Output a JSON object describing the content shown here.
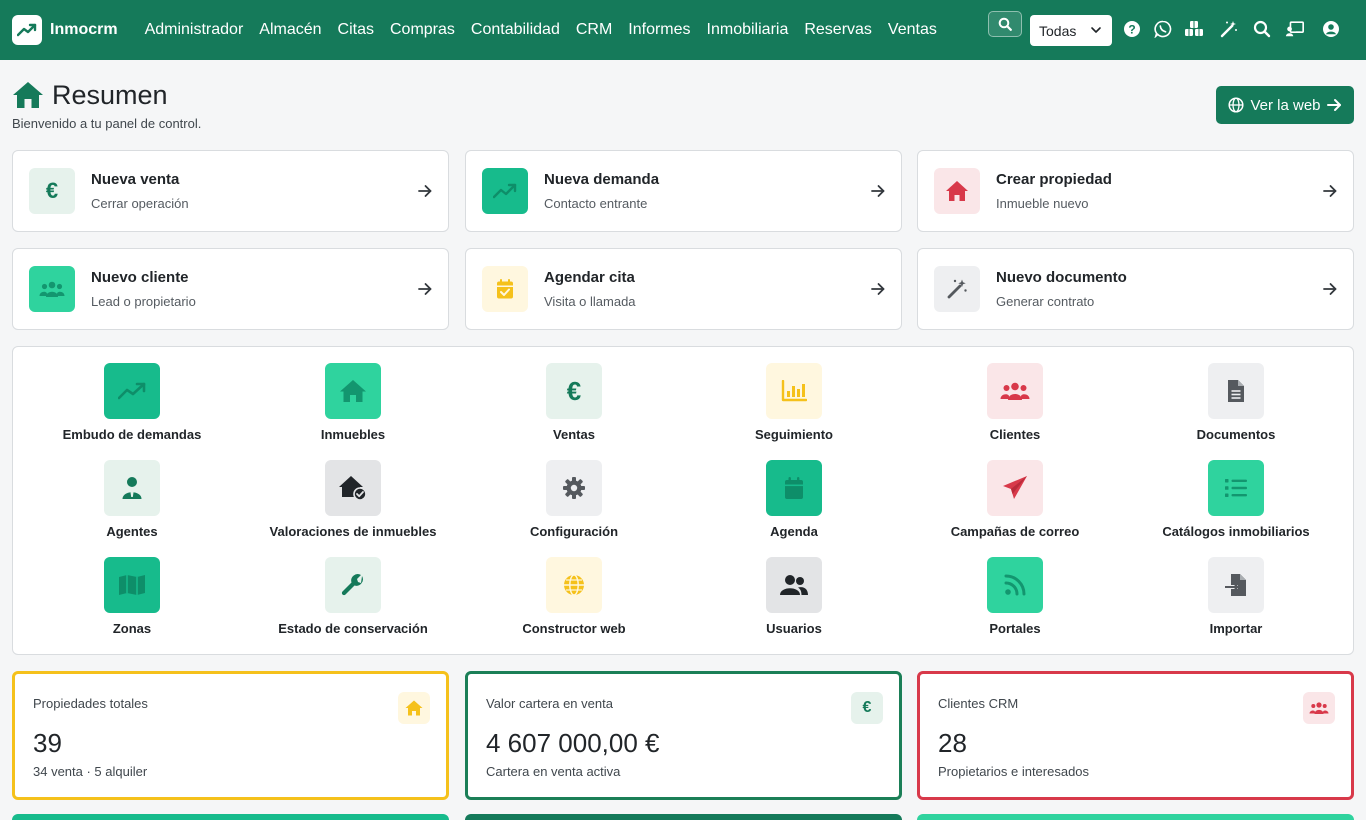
{
  "brand": {
    "name": "Inmocrm"
  },
  "nav": {
    "items": [
      "Administrador",
      "Almacén",
      "Citas",
      "Compras",
      "Contabilidad",
      "CRM",
      "Informes",
      "Inmobiliaria",
      "Reservas",
      "Ventas"
    ],
    "scope_select": "Todas"
  },
  "header": {
    "title": "Resumen",
    "subtitle": "Bienvenido a tu panel de control.",
    "web_button": "Ver la web"
  },
  "quick_actions": [
    {
      "title": "Nueva venta",
      "subtitle": "Cerrar operación",
      "icon": "euro-icon"
    },
    {
      "title": "Nueva demanda",
      "subtitle": "Contacto entrante",
      "icon": "trend-up-icon"
    },
    {
      "title": "Crear propiedad",
      "subtitle": "Inmueble nuevo",
      "icon": "home-icon"
    },
    {
      "title": "Nuevo cliente",
      "subtitle": "Lead o propietario",
      "icon": "users-icon"
    },
    {
      "title": "Agendar cita",
      "subtitle": "Visita o llamada",
      "icon": "calendar-check-icon"
    },
    {
      "title": "Nuevo documento",
      "subtitle": "Generar contrato",
      "icon": "magic-wand-icon"
    }
  ],
  "apps": [
    {
      "label": "Embudo de demandas",
      "icon": "trend-up-icon"
    },
    {
      "label": "Inmuebles",
      "icon": "home-icon"
    },
    {
      "label": "Ventas",
      "icon": "euro-icon"
    },
    {
      "label": "Seguimiento",
      "icon": "bar-chart-icon"
    },
    {
      "label": "Clientes",
      "icon": "users-icon"
    },
    {
      "label": "Documentos",
      "icon": "file-icon"
    },
    {
      "label": "Agentes",
      "icon": "user-tie-icon"
    },
    {
      "label": "Valoraciones de inmuebles",
      "icon": "home-check-icon"
    },
    {
      "label": "Configuración",
      "icon": "gear-icon"
    },
    {
      "label": "Agenda",
      "icon": "calendar-icon"
    },
    {
      "label": "Campañas de correo",
      "icon": "paper-plane-icon"
    },
    {
      "label": "Catálogos inmobiliarios",
      "icon": "list-icon"
    },
    {
      "label": "Zonas",
      "icon": "map-icon"
    },
    {
      "label": "Estado de conservación",
      "icon": "wrench-icon"
    },
    {
      "label": "Constructor web",
      "icon": "globe-icon"
    },
    {
      "label": "Usuarios",
      "icon": "user-group-icon"
    },
    {
      "label": "Portales",
      "icon": "rss-icon"
    },
    {
      "label": "Importar",
      "icon": "file-import-icon"
    }
  ],
  "stats": [
    {
      "label": "Propiedades totales",
      "value": "39",
      "sub": "34 venta · 5 alquiler",
      "icon": "home-icon",
      "color": "#f5c11b"
    },
    {
      "label": "Valor cartera en venta",
      "value": "4 607 000,00 €",
      "sub": "Cartera en venta activa",
      "icon": "euro-icon",
      "color": "#1b7f57"
    },
    {
      "label": "Clientes CRM",
      "value": "28",
      "sub": "Propietarios e interesados",
      "icon": "users-icon",
      "color": "#d8394a"
    }
  ],
  "colors": {
    "primary": "#157a5a",
    "teal": "#17bb8c",
    "mint": "#2fd39e",
    "red": "#d8394a",
    "yellow": "#f5c11b",
    "dark": "#212529"
  }
}
